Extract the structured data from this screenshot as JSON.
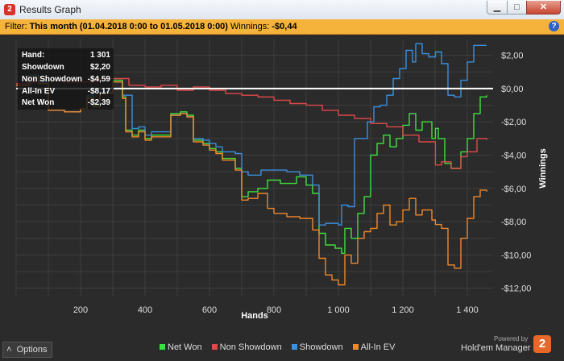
{
  "window": {
    "title": "Results Graph",
    "app_icon": "2",
    "minimize_glyph": "▁",
    "maximize_glyph": "□",
    "close_glyph": "✕"
  },
  "filter": {
    "prefix": "Filter:",
    "range": "This month (01.04.2018 0:00 to 01.05.2018 0:00)",
    "winnings_label": "Winnings:",
    "winnings_value": "-$0,44",
    "help_glyph": "?"
  },
  "tooltip": {
    "rows": [
      {
        "label": "Hand:",
        "value": "1 301"
      },
      {
        "label": "Showdown",
        "value": "$2,20"
      },
      {
        "label": "Non Showdown",
        "value": "-$4,59"
      },
      {
        "label": "All-In EV",
        "value": "-$8,17"
      },
      {
        "label": "Net Won",
        "value": "-$2,39"
      }
    ]
  },
  "options_button": {
    "glyph": "˄",
    "label": "Options"
  },
  "branding": {
    "powered": "Powered by",
    "name": "Hold'em Manager",
    "logo": "2"
  },
  "colors": {
    "net_won": "#3fe03f",
    "non_showdown": "#e04848",
    "showdown": "#3b8fe0",
    "all_in_ev": "#f0882a",
    "background": "#2b2b2b",
    "filter_bar": "#f6b33b"
  },
  "chart_data": {
    "type": "line",
    "xlabel": "Hands",
    "ylabel": "Winnings",
    "xlim": [
      0,
      1480
    ],
    "ylim": [
      -12.5,
      3.0
    ],
    "x_ticks": [
      200,
      400,
      600,
      800,
      1000,
      1200,
      1400
    ],
    "x_tick_labels": [
      "200",
      "400",
      "600",
      "800",
      "1 000",
      "1 200",
      "1 400"
    ],
    "y_ticks": [
      2,
      0,
      -2,
      -4,
      -6,
      -8,
      -10,
      -12
    ],
    "y_tick_labels": [
      "$2,00",
      "$0,00",
      "-$2,00",
      "-$4,00",
      "-$6,00",
      "-$8,00",
      "-$10,00",
      "-$12,00"
    ],
    "grid": true,
    "legend_position": "bottom",
    "hover_hand": 1301,
    "series": [
      {
        "name": "Net Won",
        "color_key": "net_won",
        "points": [
          [
            0,
            0.2
          ],
          [
            40,
            0.8
          ],
          [
            70,
            0.5
          ],
          [
            100,
            -1.3
          ],
          [
            150,
            -1.4
          ],
          [
            200,
            -1.2
          ],
          [
            220,
            -0.5
          ],
          [
            240,
            -1.0
          ],
          [
            260,
            -0.2
          ],
          [
            300,
            0.5
          ],
          [
            330,
            -0.5
          ],
          [
            340,
            -2.5
          ],
          [
            360,
            -2.8
          ],
          [
            380,
            -2.5
          ],
          [
            400,
            -3.0
          ],
          [
            420,
            -2.8
          ],
          [
            460,
            -2.8
          ],
          [
            480,
            -1.5
          ],
          [
            510,
            -1.4
          ],
          [
            530,
            -1.6
          ],
          [
            550,
            -3.1
          ],
          [
            580,
            -3.3
          ],
          [
            600,
            -3.6
          ],
          [
            620,
            -3.8
          ],
          [
            640,
            -4.2
          ],
          [
            680,
            -4.8
          ],
          [
            700,
            -6.5
          ],
          [
            720,
            -6.2
          ],
          [
            750,
            -6.0
          ],
          [
            780,
            -5.5
          ],
          [
            820,
            -5.7
          ],
          [
            850,
            -5.7
          ],
          [
            870,
            -5.3
          ],
          [
            900,
            -5.8
          ],
          [
            920,
            -6.3
          ],
          [
            940,
            -8.7
          ],
          [
            960,
            -9.4
          ],
          [
            990,
            -9.6
          ],
          [
            1010,
            -9.9
          ],
          [
            1020,
            -8.4
          ],
          [
            1040,
            -9.0
          ],
          [
            1060,
            -7.5
          ],
          [
            1080,
            -6.5
          ],
          [
            1100,
            -4.0
          ],
          [
            1120,
            -3.3
          ],
          [
            1140,
            -2.8
          ],
          [
            1160,
            -3.5
          ],
          [
            1180,
            -3.0
          ],
          [
            1200,
            -2.2
          ],
          [
            1220,
            -1.5
          ],
          [
            1240,
            -2.5
          ],
          [
            1260,
            -2.0
          ],
          [
            1290,
            -3.0
          ],
          [
            1301,
            -2.39
          ],
          [
            1310,
            -3.0
          ],
          [
            1330,
            -4.5
          ],
          [
            1350,
            -4.8
          ],
          [
            1380,
            -3.8
          ],
          [
            1400,
            -3.0
          ],
          [
            1420,
            -1.5
          ],
          [
            1440,
            -0.5
          ],
          [
            1460,
            -0.4
          ]
        ]
      },
      {
        "name": "Non Showdown",
        "color_key": "non_showdown",
        "points": [
          [
            0,
            0.3
          ],
          [
            50,
            0.4
          ],
          [
            100,
            0.5
          ],
          [
            150,
            0.4
          ],
          [
            200,
            0.4
          ],
          [
            250,
            0.6
          ],
          [
            300,
            0.6
          ],
          [
            350,
            0.2
          ],
          [
            400,
            0.1
          ],
          [
            450,
            0.2
          ],
          [
            500,
            -0.1
          ],
          [
            550,
            0.1
          ],
          [
            600,
            -0.1
          ],
          [
            650,
            -0.3
          ],
          [
            700,
            -0.4
          ],
          [
            750,
            -0.5
          ],
          [
            800,
            -0.7
          ],
          [
            850,
            -0.9
          ],
          [
            900,
            -1.0
          ],
          [
            950,
            -1.3
          ],
          [
            1000,
            -1.6
          ],
          [
            1050,
            -1.8
          ],
          [
            1100,
            -2.1
          ],
          [
            1150,
            -2.3
          ],
          [
            1200,
            -2.8
          ],
          [
            1250,
            -3.2
          ],
          [
            1301,
            -4.59
          ],
          [
            1320,
            -4.4
          ],
          [
            1350,
            -4.8
          ],
          [
            1380,
            -4.1
          ],
          [
            1400,
            -3.8
          ],
          [
            1430,
            -3.0
          ],
          [
            1460,
            -3.1
          ]
        ]
      },
      {
        "name": "Showdown",
        "color_key": "showdown",
        "points": [
          [
            0,
            0.2
          ],
          [
            40,
            0.8
          ],
          [
            70,
            0.4
          ],
          [
            100,
            -1.3
          ],
          [
            150,
            -1.4
          ],
          [
            200,
            -1.2
          ],
          [
            220,
            -0.4
          ],
          [
            240,
            -0.9
          ],
          [
            260,
            -0.2
          ],
          [
            300,
            0.4
          ],
          [
            330,
            -0.4
          ],
          [
            360,
            -2.4
          ],
          [
            380,
            -2.3
          ],
          [
            400,
            -2.8
          ],
          [
            420,
            -2.6
          ],
          [
            460,
            -2.6
          ],
          [
            480,
            -1.6
          ],
          [
            510,
            -1.5
          ],
          [
            530,
            -1.7
          ],
          [
            550,
            -3.0
          ],
          [
            580,
            -3.1
          ],
          [
            600,
            -3.3
          ],
          [
            620,
            -3.5
          ],
          [
            640,
            -3.8
          ],
          [
            680,
            -3.9
          ],
          [
            700,
            -5.0
          ],
          [
            720,
            -5.2
          ],
          [
            760,
            -4.9
          ],
          [
            800,
            -4.9
          ],
          [
            840,
            -5.0
          ],
          [
            880,
            -5.2
          ],
          [
            920,
            -5.8
          ],
          [
            940,
            -8.2
          ],
          [
            960,
            -8.1
          ],
          [
            980,
            -8.1
          ],
          [
            1000,
            -8.2
          ],
          [
            1010,
            -7.0
          ],
          [
            1030,
            -7.1
          ],
          [
            1050,
            -3.0
          ],
          [
            1070,
            -3.0
          ],
          [
            1090,
            -2.0
          ],
          [
            1110,
            -1.1
          ],
          [
            1130,
            -1.0
          ],
          [
            1150,
            -0.4
          ],
          [
            1170,
            0.6
          ],
          [
            1190,
            1.2
          ],
          [
            1210,
            2.3
          ],
          [
            1230,
            1.6
          ],
          [
            1240,
            2.7
          ],
          [
            1260,
            2.1
          ],
          [
            1280,
            1.9
          ],
          [
            1301,
            2.2
          ],
          [
            1320,
            1.5
          ],
          [
            1340,
            -0.4
          ],
          [
            1360,
            -0.5
          ],
          [
            1380,
            0.5
          ],
          [
            1400,
            1.6
          ],
          [
            1420,
            2.6
          ],
          [
            1460,
            2.6
          ]
        ]
      },
      {
        "name": "All-In EV",
        "color_key": "all_in_ev",
        "points": [
          [
            0,
            0.2
          ],
          [
            40,
            0.7
          ],
          [
            70,
            0.3
          ],
          [
            100,
            -1.3
          ],
          [
            150,
            -1.4
          ],
          [
            200,
            -1.2
          ],
          [
            220,
            -0.6
          ],
          [
            240,
            -1.1
          ],
          [
            260,
            -0.3
          ],
          [
            300,
            0.4
          ],
          [
            330,
            -0.6
          ],
          [
            340,
            -2.6
          ],
          [
            360,
            -2.9
          ],
          [
            380,
            -2.6
          ],
          [
            400,
            -3.1
          ],
          [
            420,
            -2.9
          ],
          [
            460,
            -2.9
          ],
          [
            480,
            -1.6
          ],
          [
            510,
            -1.5
          ],
          [
            530,
            -1.7
          ],
          [
            550,
            -3.2
          ],
          [
            580,
            -3.4
          ],
          [
            600,
            -3.7
          ],
          [
            620,
            -3.9
          ],
          [
            640,
            -4.3
          ],
          [
            680,
            -4.9
          ],
          [
            700,
            -6.7
          ],
          [
            720,
            -6.6
          ],
          [
            750,
            -6.3
          ],
          [
            780,
            -7.2
          ],
          [
            800,
            -7.5
          ],
          [
            840,
            -7.7
          ],
          [
            880,
            -7.8
          ],
          [
            920,
            -8.5
          ],
          [
            940,
            -10.2
          ],
          [
            960,
            -11.2
          ],
          [
            980,
            -11.5
          ],
          [
            1000,
            -11.8
          ],
          [
            1020,
            -10.0
          ],
          [
            1040,
            -10.5
          ],
          [
            1060,
            -9.0
          ],
          [
            1080,
            -8.6
          ],
          [
            1100,
            -8.4
          ],
          [
            1120,
            -7.5
          ],
          [
            1140,
            -7.0
          ],
          [
            1160,
            -8.2
          ],
          [
            1180,
            -8.0
          ],
          [
            1200,
            -7.3
          ],
          [
            1220,
            -6.6
          ],
          [
            1240,
            -7.6
          ],
          [
            1260,
            -7.3
          ],
          [
            1290,
            -7.9
          ],
          [
            1301,
            -8.17
          ],
          [
            1320,
            -8.4
          ],
          [
            1340,
            -10.6
          ],
          [
            1360,
            -10.8
          ],
          [
            1380,
            -9.0
          ],
          [
            1400,
            -7.8
          ],
          [
            1420,
            -6.5
          ],
          [
            1440,
            -6.1
          ],
          [
            1460,
            -6.2
          ]
        ]
      }
    ]
  }
}
